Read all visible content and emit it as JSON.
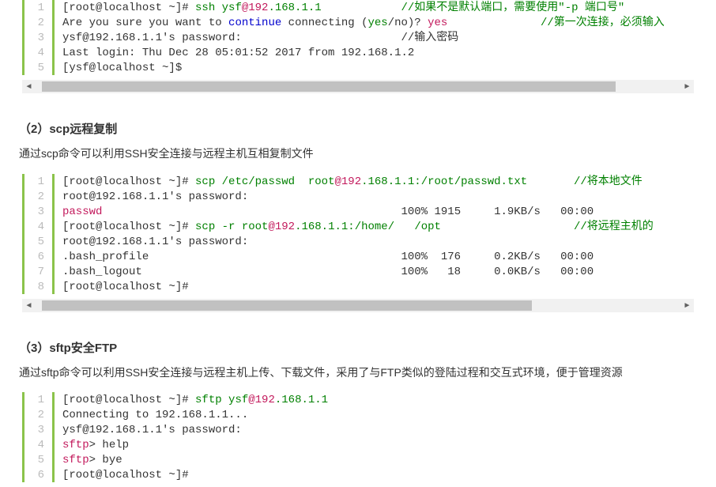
{
  "block1": {
    "lines": [
      {
        "ln": "1",
        "segs": [
          {
            "t": "[root@localhost ~]# "
          },
          {
            "t": "ssh ysf",
            "cls": "c-green"
          },
          {
            "t": "@192",
            "cls": "c-magenta"
          },
          {
            "t": ".168.1.1            ",
            "cls": "c-green"
          },
          {
            "t": "//如果不是默认端口，需要使用\"-p 端口号\"",
            "cls": "c-comment"
          }
        ]
      },
      {
        "ln": "2",
        "segs": [
          {
            "t": "Are you sure you want to "
          },
          {
            "t": "continue",
            "cls": "c-blue"
          },
          {
            "t": " connecting ("
          },
          {
            "t": "yes",
            "cls": "c-green"
          },
          {
            "t": "/no)? "
          },
          {
            "t": "yes",
            "cls": "c-magenta"
          },
          {
            "t": "              "
          },
          {
            "t": "//第一次连接，必须输入",
            "cls": "c-comment"
          }
        ]
      },
      {
        "ln": "3",
        "segs": [
          {
            "t": "ysf@192.168.1.1's password:                        //输入密码"
          }
        ]
      },
      {
        "ln": "4",
        "segs": [
          {
            "t": "Last login: Thu Dec 28 05:01:52 2017 from 192.168.1.2"
          }
        ]
      },
      {
        "ln": "5",
        "segs": [
          {
            "t": "[ysf@localhost ~]$"
          }
        ]
      }
    ],
    "thumb_left": "1%",
    "thumb_width": "89%"
  },
  "section2": {
    "title": "（2）scp远程复制",
    "desc": "通过scp命令可以利用SSH安全连接与远程主机互相复制文件"
  },
  "block2": {
    "lines": [
      {
        "ln": "1",
        "segs": [
          {
            "t": "[root@localhost ~]# "
          },
          {
            "t": "scp ",
            "cls": "c-green"
          },
          {
            "t": "/etc/",
            "cls": "c-green"
          },
          {
            "t": "passwd  root",
            "cls": "c-green"
          },
          {
            "t": "@192",
            "cls": "c-magenta"
          },
          {
            "t": ".168.1.1:",
            "cls": "c-green"
          },
          {
            "t": "/root/",
            "cls": "c-green"
          },
          {
            "t": "passwd.txt       ",
            "cls": "c-green"
          },
          {
            "t": "//将本地文件",
            "cls": "c-comment"
          }
        ]
      },
      {
        "ln": "2",
        "segs": [
          {
            "t": "root@192.168.1.1's password:"
          }
        ]
      },
      {
        "ln": "3",
        "segs": [
          {
            "t": "passwd",
            "cls": "c-magenta"
          },
          {
            "t": "                                             100% 1915     1.9KB/s   00:00"
          }
        ]
      },
      {
        "ln": "4",
        "segs": [
          {
            "t": "[root@localhost ~]# "
          },
          {
            "t": "scp -r root",
            "cls": "c-green"
          },
          {
            "t": "@192",
            "cls": "c-magenta"
          },
          {
            "t": ".168.1.1:",
            "cls": "c-green"
          },
          {
            "t": "/home/",
            "cls": "c-green"
          },
          {
            "t": "   "
          },
          {
            "t": "/opt",
            "cls": "c-green"
          },
          {
            "t": "                    "
          },
          {
            "t": "//将远程主机的",
            "cls": "c-comment"
          }
        ]
      },
      {
        "ln": "5",
        "segs": [
          {
            "t": "root@192.168.1.1's password:"
          }
        ]
      },
      {
        "ln": "6",
        "segs": [
          {
            "t": ".bash_profile                                      100%  176     0.2KB/s   00:00"
          }
        ]
      },
      {
        "ln": "7",
        "segs": [
          {
            "t": ".bash_logout                                       100%   18     0.0KB/s   00:00"
          }
        ]
      },
      {
        "ln": "8",
        "segs": [
          {
            "t": "[root@localhost ~]#"
          }
        ]
      }
    ],
    "thumb_left": "1%",
    "thumb_width": "76%"
  },
  "section3": {
    "title": "（3）sftp安全FTP",
    "desc": "通过sftp命令可以利用SSH安全连接与远程主机上传、下载文件，采用了与FTP类似的登陆过程和交互式环境，便于管理资源"
  },
  "block3": {
    "lines": [
      {
        "ln": "1",
        "segs": [
          {
            "t": "[root@localhost ~]# "
          },
          {
            "t": "sftp ysf",
            "cls": "c-green"
          },
          {
            "t": "@192",
            "cls": "c-magenta"
          },
          {
            "t": ".168.1.1",
            "cls": "c-green"
          }
        ]
      },
      {
        "ln": "2",
        "segs": [
          {
            "t": "Connecting to 192.168.1.1..."
          }
        ]
      },
      {
        "ln": "3",
        "segs": [
          {
            "t": "ysf@192.168.1.1's password:"
          }
        ]
      },
      {
        "ln": "4",
        "segs": [
          {
            "t": "sftp",
            "cls": "c-magenta"
          },
          {
            "t": "> help"
          }
        ]
      },
      {
        "ln": "5",
        "segs": [
          {
            "t": "sftp",
            "cls": "c-magenta"
          },
          {
            "t": "> bye"
          }
        ]
      },
      {
        "ln": "6",
        "segs": [
          {
            "t": "[root@localhost ~]#"
          }
        ]
      }
    ]
  }
}
